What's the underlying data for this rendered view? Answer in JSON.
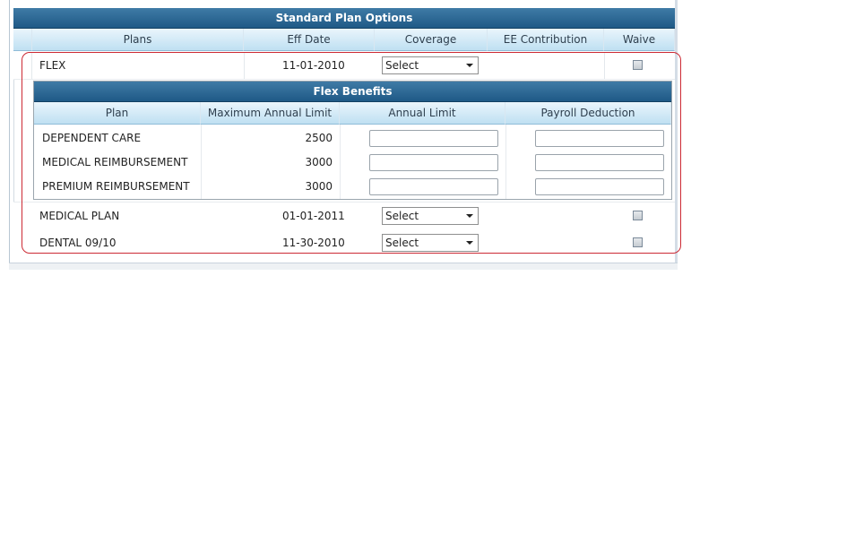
{
  "main_table": {
    "title": "Standard Plan Options",
    "columns": [
      "Plans",
      "Eff Date",
      "Coverage",
      "EE Contribution",
      "Waive"
    ],
    "rows": [
      {
        "plan": "FLEX",
        "eff_date": "11-01-2010",
        "coverage": "Select"
      },
      {
        "plan": "MEDICAL PLAN",
        "eff_date": "01-01-2011",
        "coverage": "Select"
      },
      {
        "plan": "DENTAL 09/10",
        "eff_date": "11-30-2010",
        "coverage": "Select"
      }
    ]
  },
  "flex_table": {
    "title": "Flex Benefits",
    "columns": [
      "Plan",
      "Maximum Annual Limit",
      "Annual Limit",
      "Payroll Deduction"
    ],
    "rows": [
      {
        "plan": "DEPENDENT CARE",
        "max_limit": "2500"
      },
      {
        "plan": "MEDICAL REIMBURSEMENT",
        "max_limit": "3000"
      },
      {
        "plan": "PREMIUM REIMBURSEMENT",
        "max_limit": "3000"
      }
    ]
  },
  "colors": {
    "title_bar": "#1f5986",
    "header_bg": "#bfe0f2",
    "highlight_border": "#cc2a34"
  }
}
